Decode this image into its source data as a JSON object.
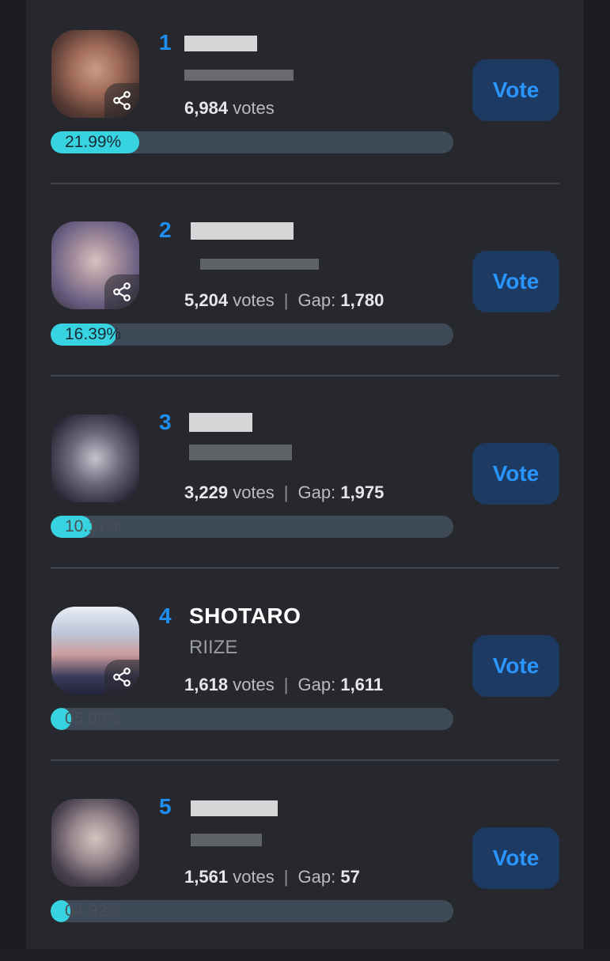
{
  "button_label": "Vote",
  "gap_label": "Gap:",
  "votes_word": "votes",
  "colors": {
    "accent": "#1f8ef1",
    "progress": "#38d3e0",
    "vote_button_bg": "#1d3a63",
    "panel_bg": "#27282d"
  },
  "icons": {
    "share": "share-icon"
  },
  "candidates": [
    {
      "rank": "1",
      "name": "",
      "group": "",
      "votes": "6,984",
      "gap": "",
      "percent_text": "21.99%",
      "fill_fraction": 0.2199
    },
    {
      "rank": "2",
      "name": "",
      "group": "",
      "votes": "5,204",
      "gap": "1,780",
      "percent_text": "16.39%",
      "fill_fraction": 0.1639
    },
    {
      "rank": "3",
      "name": "",
      "group": "",
      "votes": "3,229",
      "gap": "1,975",
      "percent_text": "10.17%",
      "fill_fraction": 0.1017
    },
    {
      "rank": "4",
      "name": "SHOTARO",
      "group": "RIIZE",
      "votes": "1,618",
      "gap": "1,611",
      "percent_text": "05.09%",
      "fill_fraction": 0.0509
    },
    {
      "rank": "5",
      "name": "",
      "group": "",
      "votes": "1,561",
      "gap": "57",
      "percent_text": "04.92%",
      "fill_fraction": 0.0492
    }
  ]
}
